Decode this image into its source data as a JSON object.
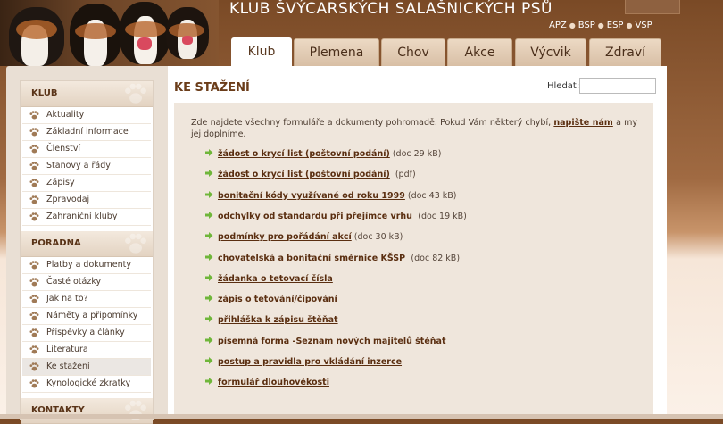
{
  "header": {
    "site_title": "KLUB ŠVÝCARSKÝCH SALAŠNICKÝCH PSŮ",
    "clubs": [
      "APZ",
      "BSP",
      "ESP",
      "VSP"
    ]
  },
  "tabs": [
    {
      "label": "Klub",
      "active": true
    },
    {
      "label": "Plemena",
      "active": false
    },
    {
      "label": "Chov",
      "active": false
    },
    {
      "label": "Akce",
      "active": false
    },
    {
      "label": "Výcvik",
      "active": false
    },
    {
      "label": "Zdraví",
      "active": false
    }
  ],
  "sidebar": {
    "sections": [
      {
        "title": "KLUB",
        "items": [
          "Aktuality",
          "Základní informace",
          "Členství",
          "Stanovy a řády",
          "Zápisy",
          "Zpravodaj",
          "Zahraniční kluby"
        ]
      },
      {
        "title": "PORADNA",
        "items": [
          "Platby a dokumenty",
          "Časté otázky",
          "Jak na to?",
          "Náměty a připomínky",
          "Příspěvky a články",
          "Literatura",
          "Ke stažení",
          "Kynologické zkratky"
        ]
      },
      {
        "title": "KONTAKTY",
        "items": []
      }
    ],
    "active_item": "Ke stažení"
  },
  "content": {
    "title": "KE STAŽENÍ",
    "search_label": "Hledat:",
    "search_value": "",
    "intro_before": "Zde najdete všechny formuláře a dokumenty pohromadě. Pokud Vám některý chybí,",
    "intro_link": "napište nám",
    "intro_after": "a my jej doplníme.",
    "documents": [
      {
        "link": "žádost o krycí list (poštovní podání)",
        "meta": "(doc 29 kB)"
      },
      {
        "link": "žádost o krycí list (poštovní podání)",
        "meta": " (pdf)"
      },
      {
        "link": "bonitační kódy využívané od roku 1999",
        "meta": "(doc 43 kB)"
      },
      {
        "link": "odchylky od standardu při přejímce vrhu ",
        "meta": "(doc 19 kB)"
      },
      {
        "link": "podmínky pro pořádání akcí",
        "meta": "(doc 30 kB)"
      },
      {
        "link": "chovatelská a bonitační směrnice KŠSP ",
        "meta": "(doc 82 kB)"
      },
      {
        "link": "žádanka o tetovací čísla",
        "meta": ""
      },
      {
        "link": "zápis o tetování/čipování",
        "meta": ""
      },
      {
        "link": "přihláška k zápisu štěňat",
        "meta": ""
      },
      {
        "link": "písemná forma -Seznam nových majitelů štěňat",
        "meta": ""
      },
      {
        "link": "postup a pravidla pro vkládání inzerce",
        "meta": ""
      },
      {
        "link": "formulář dlouhověkosti",
        "meta": ""
      }
    ]
  },
  "colors": {
    "accent_brown": "#6b3d1a",
    "bullet_green": "#6fb63a",
    "header_brown": "#7a4a26"
  },
  "icons": {
    "sidebar_bullet": "paw-icon",
    "document_bullet": "arrow-right-icon"
  }
}
